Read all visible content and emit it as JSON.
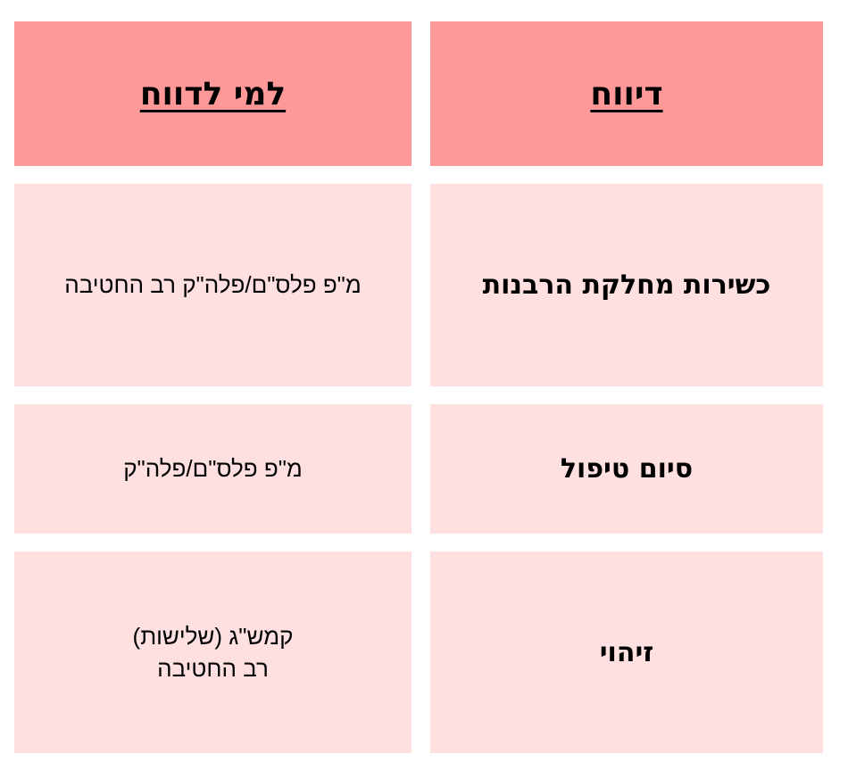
{
  "table": {
    "header": {
      "report": "דיווח",
      "recipient": "למי לדווח"
    },
    "rows": [
      {
        "report": "כשירות מחלקת הרבנות",
        "recipient_lines": [
          "מ\"פ פלס\"ם/פלה\"ק רב החטיבה"
        ]
      },
      {
        "report": "סיום טיפול",
        "recipient_lines": [
          "מ\"פ פלס\"ם/פלה\"ק"
        ]
      },
      {
        "report": "זיהוי",
        "recipient_lines": [
          "קמש\"ג (שלישות)",
          "רב החטיבה"
        ]
      }
    ]
  },
  "colors": {
    "header_bg": "#ff9999",
    "body_bg": "#ffe0e0"
  }
}
